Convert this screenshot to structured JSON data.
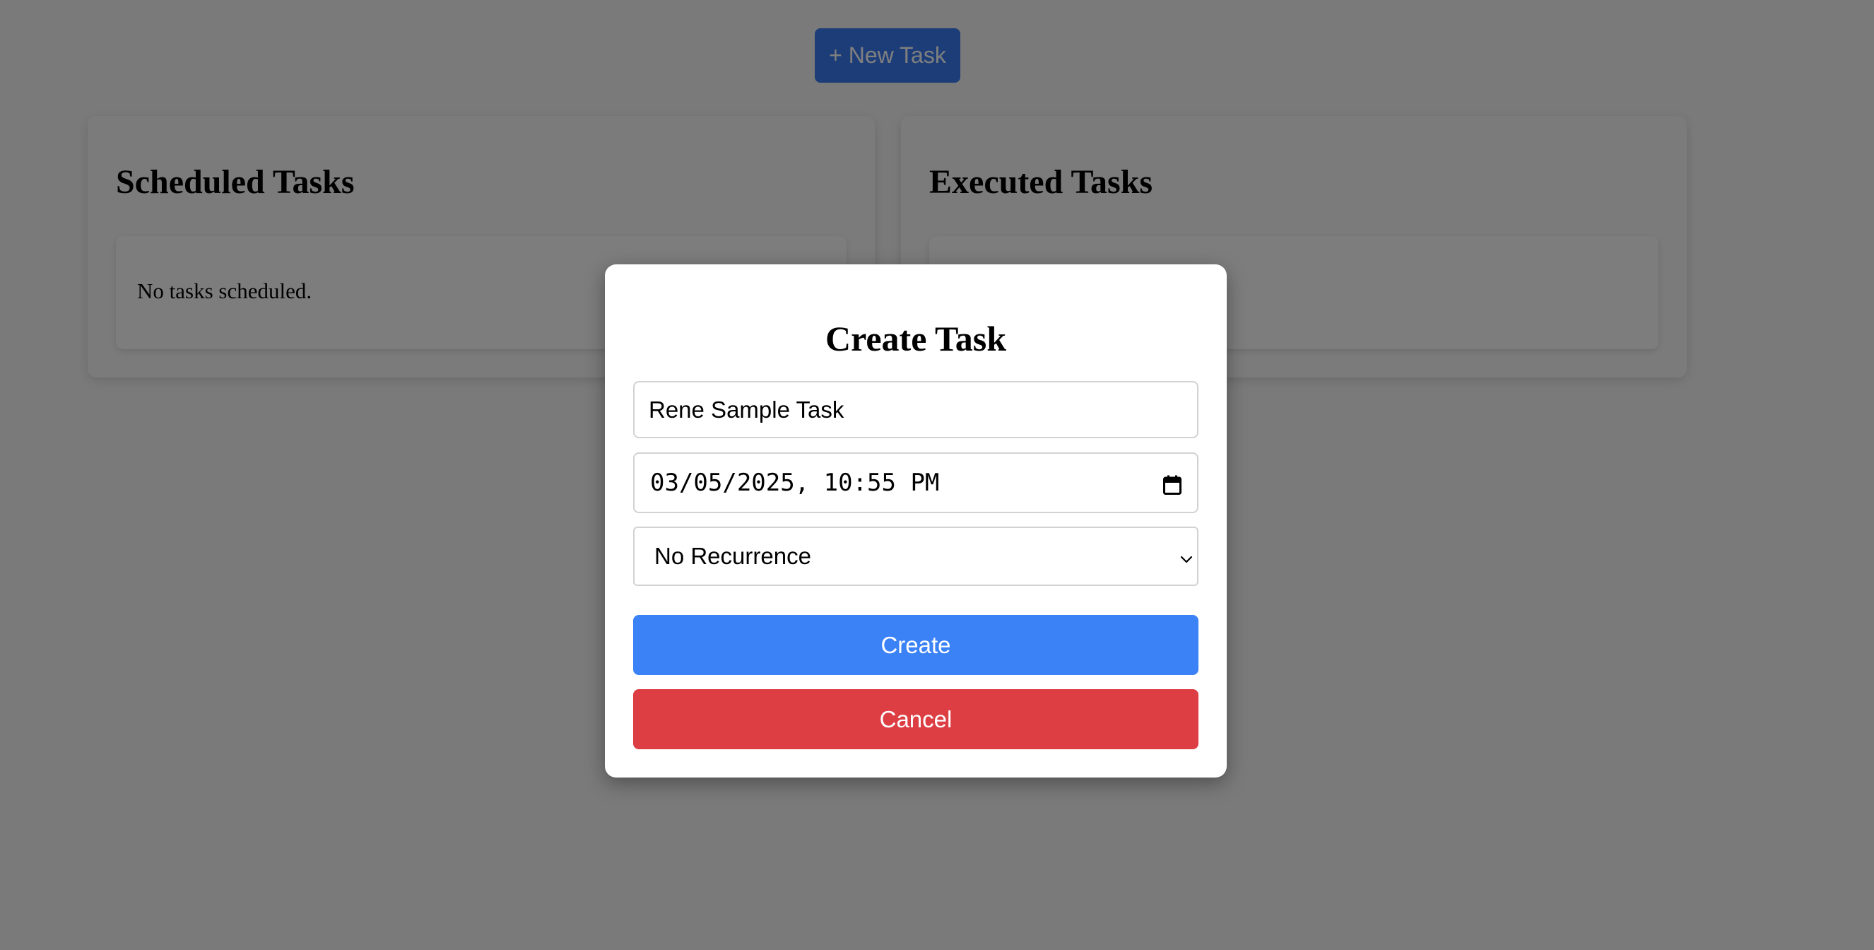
{
  "header": {
    "new_task_label": "+ New Task"
  },
  "scheduled": {
    "title": "Scheduled Tasks",
    "empty_text": "No tasks scheduled."
  },
  "executed": {
    "title": "Executed Tasks"
  },
  "modal": {
    "title": "Create Task",
    "task_name_value": "Rene Sample Task",
    "datetime_value": "03/05/2025, 10:55 PM",
    "recurrence_value": "No Recurrence",
    "create_label": "Create",
    "cancel_label": "Cancel"
  },
  "icons": {
    "datetime": "calendar-icon",
    "select": "chevron-down-icon"
  },
  "colors": {
    "primary": "#3b82f6",
    "danger": "#dc3e44",
    "overlay": "rgba(0,0,0,0.5)"
  }
}
